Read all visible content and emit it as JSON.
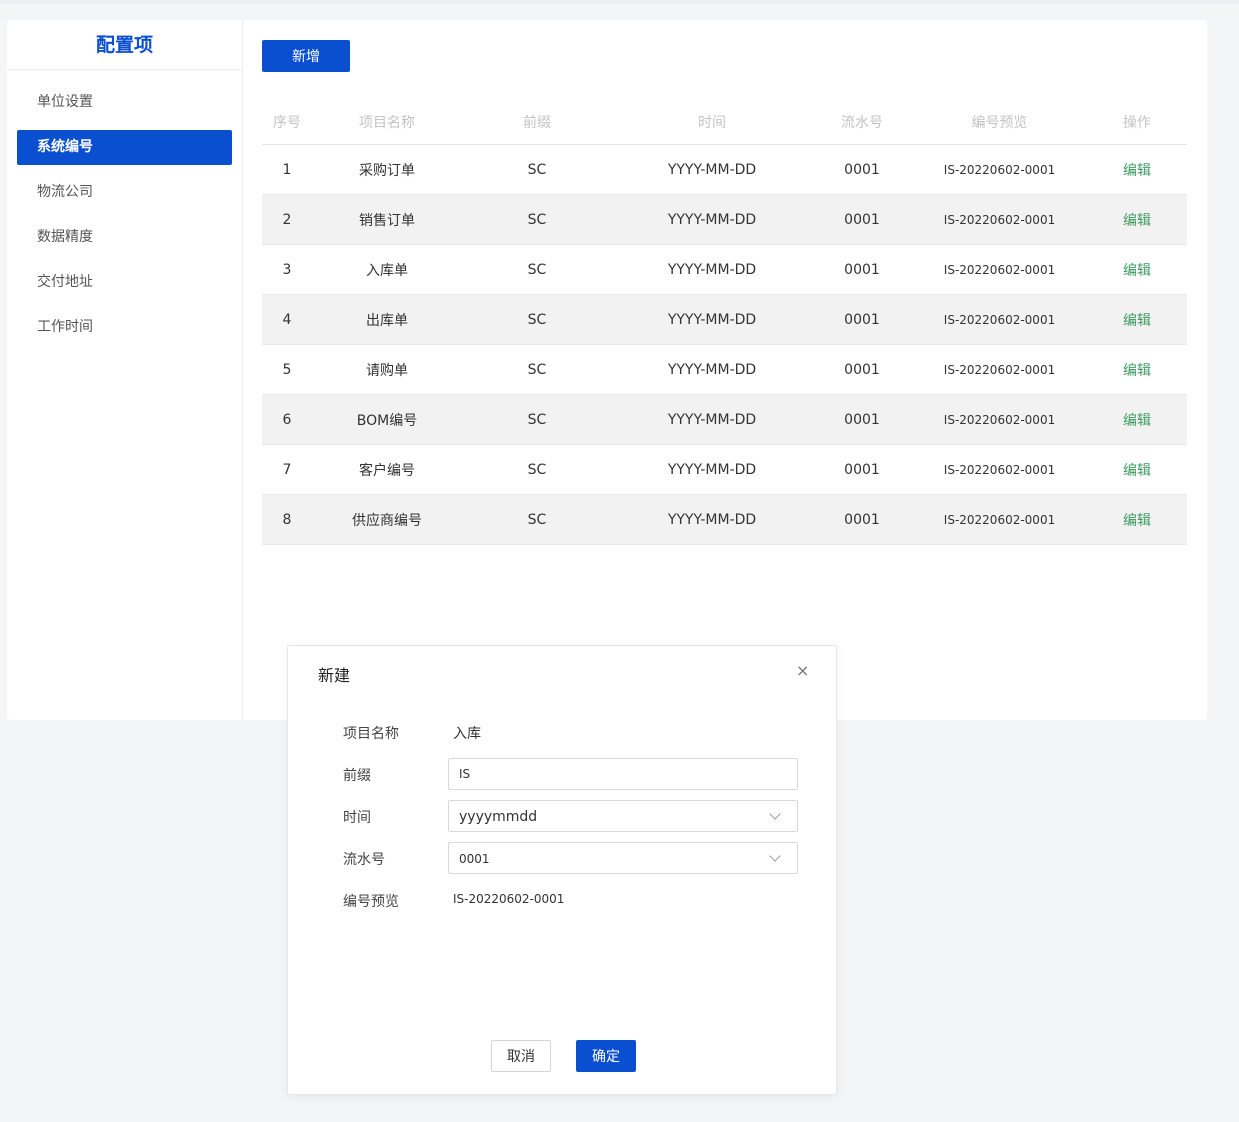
{
  "sidebar": {
    "title": "配置项",
    "items": [
      {
        "label": "单位设置",
        "active": false
      },
      {
        "label": "系统编号",
        "active": true
      },
      {
        "label": "物流公司",
        "active": false
      },
      {
        "label": "数据精度",
        "active": false
      },
      {
        "label": "交付地址",
        "active": false
      },
      {
        "label": "工作时间",
        "active": false
      }
    ]
  },
  "toolbar": {
    "add_label": "新增"
  },
  "table": {
    "headers": [
      "序号",
      "项目名称",
      "前缀",
      "时间",
      "流水号",
      "编号预览",
      "操作"
    ],
    "rows": [
      {
        "no": "1",
        "name": "采购订单",
        "prefix": "SC",
        "time": "YYYY-MM-DD",
        "serial": "0001",
        "preview": "IS-20220602-0001",
        "action": "编辑"
      },
      {
        "no": "2",
        "name": "销售订单",
        "prefix": "SC",
        "time": "YYYY-MM-DD",
        "serial": "0001",
        "preview": "IS-20220602-0001",
        "action": "编辑"
      },
      {
        "no": "3",
        "name": "入库单",
        "prefix": "SC",
        "time": "YYYY-MM-DD",
        "serial": "0001",
        "preview": "IS-20220602-0001",
        "action": "编辑"
      },
      {
        "no": "4",
        "name": "出库单",
        "prefix": "SC",
        "time": "YYYY-MM-DD",
        "serial": "0001",
        "preview": "IS-20220602-0001",
        "action": "编辑"
      },
      {
        "no": "5",
        "name": "请购单",
        "prefix": "SC",
        "time": "YYYY-MM-DD",
        "serial": "0001",
        "preview": "IS-20220602-0001",
        "action": "编辑"
      },
      {
        "no": "6",
        "name": "BOM编号",
        "prefix": "SC",
        "time": "YYYY-MM-DD",
        "serial": "0001",
        "preview": "IS-20220602-0001",
        "action": "编辑"
      },
      {
        "no": "7",
        "name": "客户编号",
        "prefix": "SC",
        "time": "YYYY-MM-DD",
        "serial": "0001",
        "preview": "IS-20220602-0001",
        "action": "编辑"
      },
      {
        "no": "8",
        "name": "供应商编号",
        "prefix": "SC",
        "time": "YYYY-MM-DD",
        "serial": "0001",
        "preview": "IS-20220602-0001",
        "action": "编辑"
      }
    ]
  },
  "modal": {
    "title": "新建",
    "close_icon": "close-icon",
    "fields": {
      "name_label": "项目名称",
      "name_value": "入库",
      "prefix_label": "前缀",
      "prefix_value": "IS",
      "time_label": "时间",
      "time_value": "yyyymmdd",
      "serial_label": "流水号",
      "serial_value": "0001",
      "preview_label": "编号预览",
      "preview_value": "IS-20220602-0001"
    },
    "cancel_label": "取消",
    "ok_label": "确定"
  },
  "colors": {
    "primary": "#0b4fd1",
    "link": "#3d9b61",
    "row_alt": "#f2f2f2",
    "background": "#f4f5f7"
  }
}
